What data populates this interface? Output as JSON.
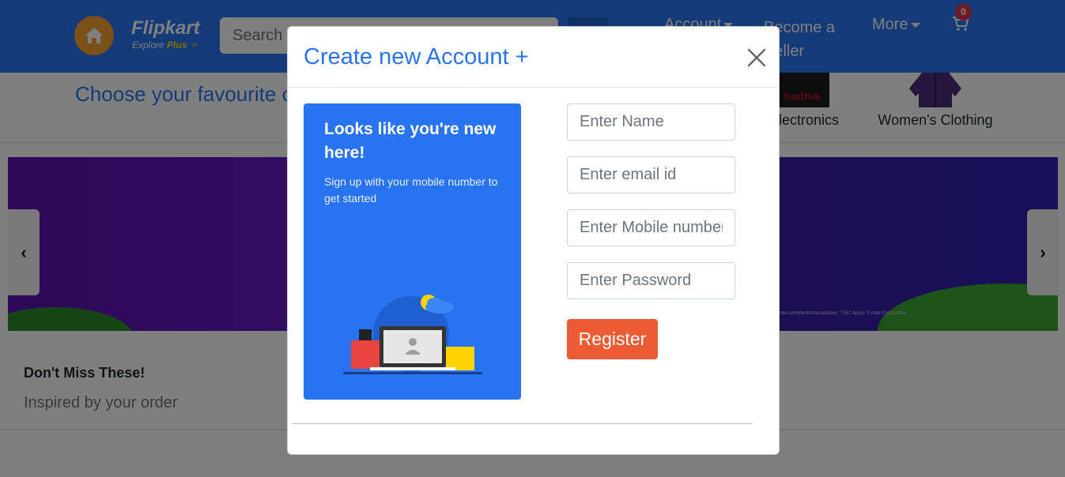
{
  "navbar": {
    "brand": "Flipkart",
    "brand_sub": "Explore",
    "brand_plus": "Plus",
    "search_placeholder": "Search for products, brands and more",
    "account_label": "Account",
    "become_seller_line1": "Become a",
    "become_seller_line2": "Seller",
    "more_label": "More",
    "cart_count": "0"
  },
  "categories": {
    "title": "Choose your favourite category",
    "items": [
      {
        "label": "Electronics",
        "icon": "sandisk-card-icon",
        "img_text": "SanDisk"
      },
      {
        "label": "Women's Clothing",
        "icon": "jacket-icon"
      }
    ]
  },
  "banner": {
    "fine_print": "intel.com/performanceindex. *T&C Apply. © Intel Corporation."
  },
  "deals": {
    "title": "Don't Miss These!",
    "subtitle": "Inspired by your order"
  },
  "modal": {
    "title": "Create new Account +",
    "promo_title": "Looks like you're new here!",
    "promo_sub": "Sign up with your mobile number to get started",
    "fields": {
      "name_placeholder": "Enter Name",
      "email_placeholder": "Enter email id",
      "mobile_placeholder": "Enter Mobile number",
      "password_placeholder": "Enter Password"
    },
    "register_label": "Register"
  },
  "colors": {
    "primary": "#2874f0",
    "register": "#ec5b34",
    "badge": "#dc3545"
  }
}
